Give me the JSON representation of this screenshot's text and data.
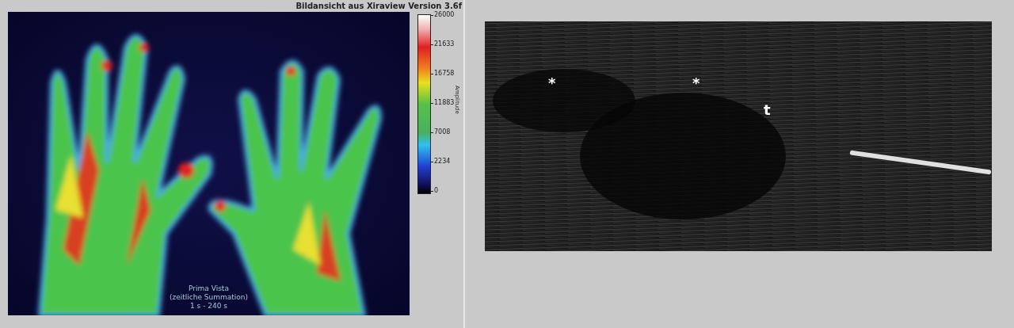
{
  "thermal_view": {
    "title": "Bildansicht aus Xiraview Version 3.6f",
    "colorbar": {
      "label": "Amplitude",
      "ticks": [
        "26000",
        "21633",
        "16758",
        "11883",
        "7008",
        "2234",
        "0"
      ]
    },
    "caption": [
      "Prima Vista",
      "(zeitliche Summation)",
      "1 s - 240 s"
    ]
  },
  "ultrasound_view": {
    "markers": [
      {
        "label": "*"
      },
      {
        "label": "*"
      },
      {
        "label": "t"
      }
    ]
  }
}
